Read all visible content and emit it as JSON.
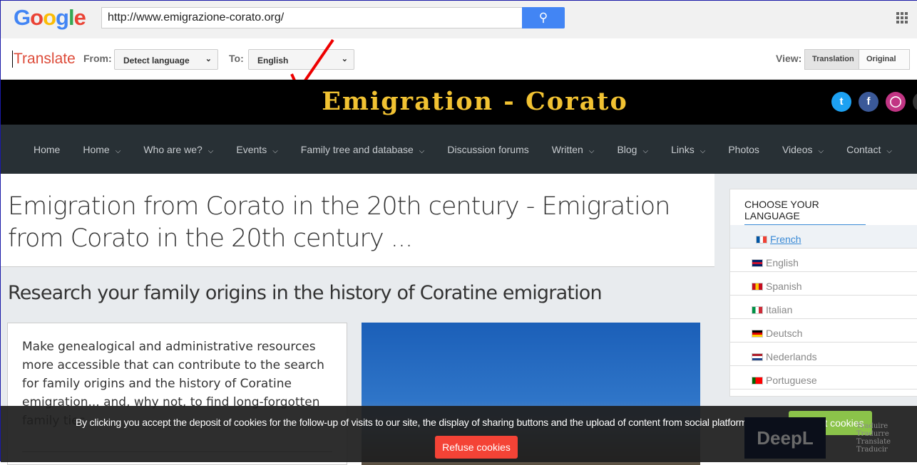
{
  "google": {
    "logo": "Google",
    "url": "http://www.emigrazione-corato.org/"
  },
  "translate_bar": {
    "title": "Translate",
    "from_label": "From:",
    "from_value": "Detect language",
    "to_label": "To:",
    "to_value": "English",
    "view_label": "View:",
    "view_translation": "Translation",
    "view_original": "Original"
  },
  "site": {
    "title": "Emigration - Corato",
    "social": [
      "twitter",
      "facebook",
      "instagram"
    ]
  },
  "nav": [
    "Home",
    "Home",
    "Who are we?",
    "Events",
    "Family tree and database",
    "Discussion forums",
    "Written",
    "Blog",
    "Links",
    "Photos",
    "Videos",
    "Contact"
  ],
  "nav_dropdown": [
    false,
    true,
    true,
    true,
    true,
    false,
    true,
    true,
    true,
    false,
    true,
    true
  ],
  "main": {
    "title": "Emigration from Corato in the 20th century - Emigration from Corato in the 20th century ...",
    "subtitle": "Research your family origins in the history of Coratine emigration",
    "card_text": "Make genealogical and administrative resources more accessible that can contribute to the search for family origins and the history of Coratine emigration... and, why not, to find long-forgotten family ties"
  },
  "sidebar": {
    "title": "CHOOSE YOUR LANGUAGE",
    "languages": [
      "French",
      "English",
      "Spanish",
      "Italian",
      "Deutsch",
      "Nederlands",
      "Portuguese"
    ],
    "active": "French",
    "deepl": "DeepL",
    "translate_words": [
      "Traduire",
      "Tradurre",
      "Translate",
      "Traducir"
    ]
  },
  "cookie": {
    "text": "By clicking you accept the deposit of cookies for the follow-up of visits to our site, the display of sharing buttons and the upload of content from social platforms.",
    "accept": "Accept cookies",
    "refuse": "Refuse cookies"
  },
  "colors": {
    "accept": "#8bc34a",
    "refuse": "#f44336",
    "site_title": "#f1c232",
    "google_blue": "#4285f4"
  }
}
